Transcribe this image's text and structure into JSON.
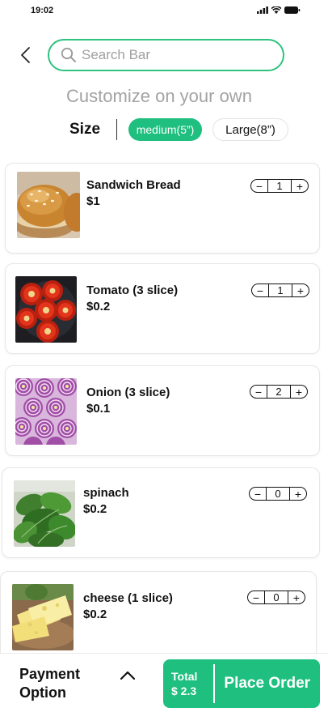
{
  "status_bar": {
    "time": "19:02"
  },
  "search": {
    "placeholder": "Search Bar",
    "value": ""
  },
  "subtitle": "Customize on your own",
  "size": {
    "label": "Size",
    "options": [
      {
        "label": "medium(5”)",
        "selected": true
      },
      {
        "label": "Large(8”)",
        "selected": false
      }
    ]
  },
  "items": [
    {
      "name": "Sandwich Bread",
      "price": "$1",
      "quantity": "1",
      "image": "bread-bun"
    },
    {
      "name": "Tomato (3 slice)",
      "price": "$0.2",
      "quantity": "1",
      "image": "tomato-slices"
    },
    {
      "name": "Onion (3 slice)",
      "price": "$0.1",
      "quantity": "2",
      "image": "onion-slices"
    },
    {
      "name": "spinach",
      "price": "$0.2",
      "quantity": "0",
      "image": "spinach-leaves"
    },
    {
      "name": "cheese (1 slice)",
      "price": "$0.2",
      "quantity": "0",
      "image": "cheese-slices"
    }
  ],
  "stepper_symbols": {
    "minus": "−",
    "plus": "+"
  },
  "bottom": {
    "payment_label": "Payment Option",
    "total_label": "Total",
    "total_value": "$ 2.3",
    "order_label": "Place Order"
  },
  "colors": {
    "accent": "#1fbf7f",
    "search_border": "#2ec27e",
    "muted_text": "#a3a3a3"
  }
}
